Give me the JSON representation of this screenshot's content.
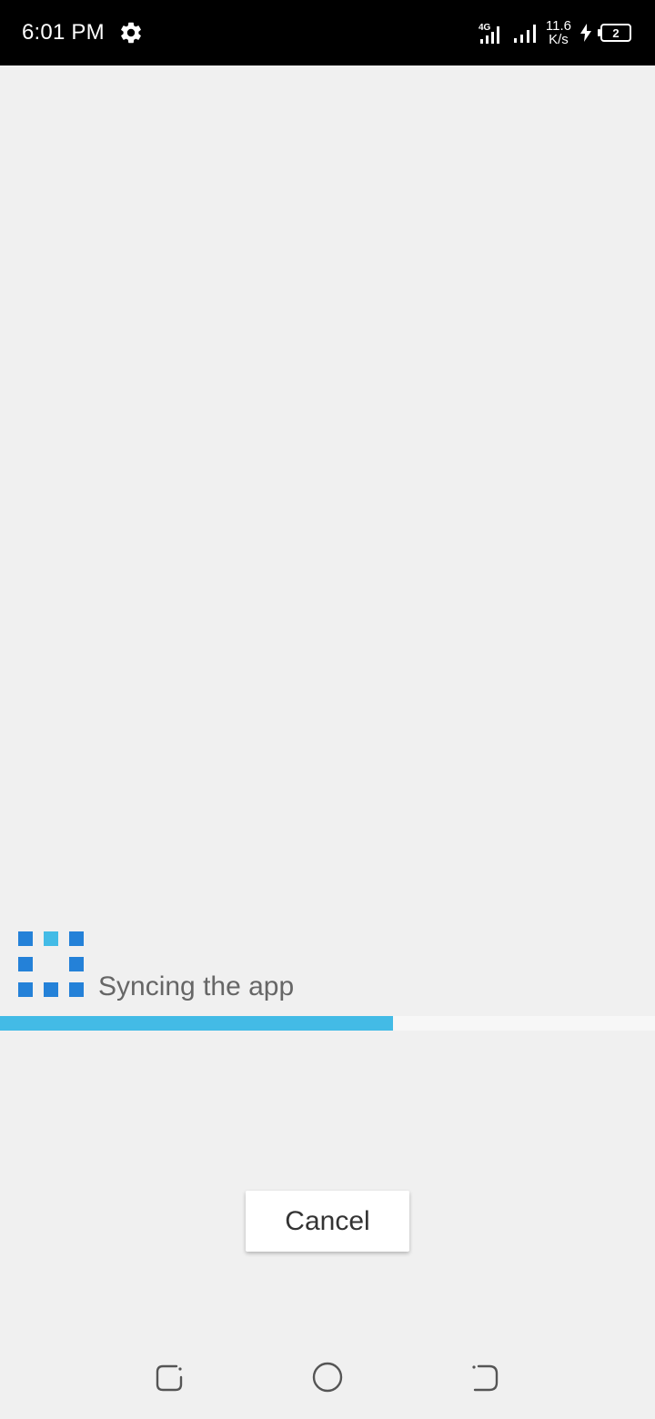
{
  "status_bar": {
    "time": "6:01 PM",
    "network_type": "4G",
    "net_speed_value": "11.6",
    "net_speed_unit": "K/s",
    "battery_level": "2"
  },
  "sync": {
    "message": "Syncing the app",
    "progress_percent": 60,
    "accent_color": "#43bbe6",
    "loader_color": "#2481d8"
  },
  "actions": {
    "cancel_label": "Cancel"
  },
  "navigation": {
    "buttons": [
      "recents-icon",
      "home-icon",
      "back-icon"
    ]
  }
}
